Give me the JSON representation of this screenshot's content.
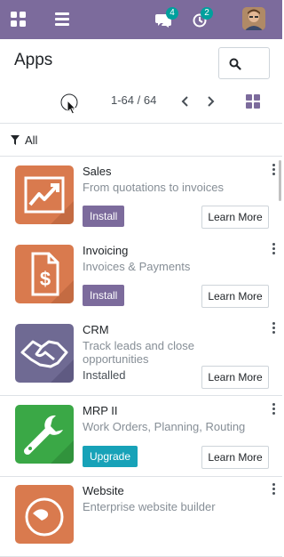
{
  "topbar": {
    "chat_count": "4",
    "activity_count": "2"
  },
  "page": {
    "title": "Apps"
  },
  "pager": {
    "value": "1-64 / 64"
  },
  "filter": {
    "label": "All"
  },
  "colors": {
    "brand": "#7c6b9c",
    "badge": "#00a09d",
    "upgrade": "#17a2b8",
    "sales_icon": "#d97a4e",
    "invoicing_icon": "#d97a4e",
    "crm_icon": "#6f6a93",
    "mrp_icon": "#3aa846",
    "website_icon": "#d97a4e"
  },
  "apps": [
    {
      "name": "Sales",
      "summary": "From quotations to invoices",
      "action": "Install",
      "secondary": "Learn More",
      "icon": "sales-chart-icon"
    },
    {
      "name": "Invoicing",
      "summary": "Invoices & Payments",
      "action": "Install",
      "secondary": "Learn More",
      "icon": "invoice-dollar-icon"
    },
    {
      "name": "CRM",
      "summary": "Track leads and close opportunities",
      "status": "Installed",
      "secondary": "Learn More",
      "icon": "handshake-icon"
    },
    {
      "name": "MRP II",
      "summary": "Work Orders, Planning, Routing",
      "action": "Upgrade",
      "secondary": "Learn More",
      "icon": "wrench-icon"
    },
    {
      "name": "Website",
      "summary": "Enterprise website builder",
      "icon": "globe-icon"
    }
  ]
}
